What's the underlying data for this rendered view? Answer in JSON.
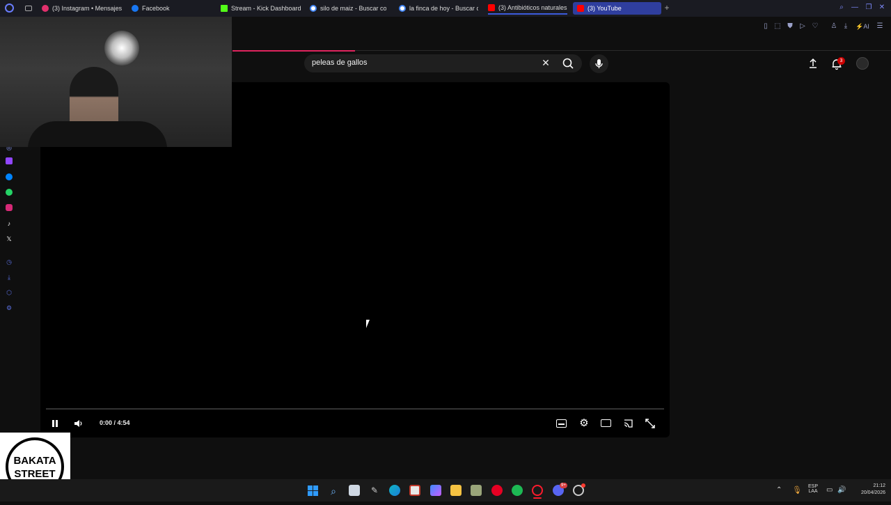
{
  "tabs": [
    {
      "label": "(3) Instagram • Mensajes",
      "color": "#e1306c"
    },
    {
      "label": "Facebook",
      "color": "#1877f2"
    },
    {
      "label": "Stream - Kick Dashboard",
      "color": "#53fc18"
    },
    {
      "label": "silo de maiz - Buscar con",
      "color": "#4285f4"
    },
    {
      "label": "la finca de hoy - Buscar c",
      "color": "#4285f4"
    },
    {
      "label": "(3) Antibióticos naturales",
      "color": "#ff0000"
    },
    {
      "label": "(3) YouTube",
      "color": "#ff0000"
    }
  ],
  "search": {
    "query": "peleas de gallos"
  },
  "header": {
    "notification_count": "3"
  },
  "player": {
    "time": "0:00 / 4:54",
    "progress_fraction": 0.0
  },
  "taskbar": {
    "lang_line1": "ESP",
    "lang_line2": "LAA",
    "clock_time": "21:12",
    "clock_date": "20/04/2026",
    "discord_badge": "9+"
  },
  "logo": {
    "text": "BAKATA STREET"
  },
  "colors": {
    "accent": "#e0245e",
    "tab_active": "#2f3e9e",
    "opera_red": "#ff1b2d"
  },
  "icons": {
    "sidebar": [
      "opera-icon",
      "twitch-icon",
      "messenger-icon",
      "whatsapp-icon",
      "instagram-icon",
      "tiktok-icon",
      "x-icon",
      "history-icon",
      "downloads-icon",
      "extensions-icon",
      "settings-icon"
    ]
  }
}
